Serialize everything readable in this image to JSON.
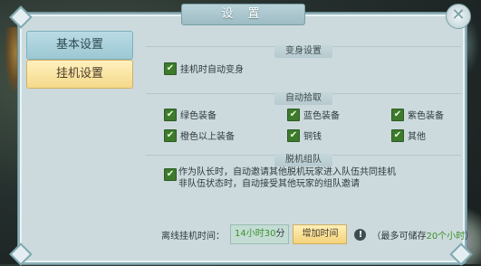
{
  "window": {
    "title": "设 置",
    "close_symbol": "✕"
  },
  "tabs": [
    {
      "label": "基本设置",
      "active": false
    },
    {
      "label": "挂机设置",
      "active": true
    }
  ],
  "sections": {
    "transform": {
      "title": "变身设置",
      "options": [
        {
          "label": "挂机时自动变身",
          "checked": true
        }
      ]
    },
    "pickup": {
      "title": "自动拾取",
      "options": [
        {
          "label": "绿色装备",
          "checked": true
        },
        {
          "label": "蓝色装备",
          "checked": true
        },
        {
          "label": "紫色装备",
          "checked": true
        },
        {
          "label": "橙色以上装备",
          "checked": true
        },
        {
          "label": "铜钱",
          "checked": true
        },
        {
          "label": "其他",
          "checked": true
        }
      ]
    },
    "team": {
      "title": "脱机组队",
      "option": {
        "checked": true,
        "line1": "作为队长时，自动邀请其他脱机玩家进入队伍共同挂机",
        "line2": "非队伍状态时，自动接受其他玩家的组队邀请"
      }
    }
  },
  "footer": {
    "label": "离线挂机时间：",
    "time": {
      "hours": "14",
      "hours_unit": "小时",
      "minutes": "30",
      "minutes_unit": "分"
    },
    "add_button": "增加时间",
    "warn_symbol": "!",
    "note_prefix": "（最多可储存",
    "note_value": "20个小时",
    "note_suffix": "）"
  },
  "colors": {
    "check_green": "#3e7a2e",
    "accent_green": "#3f8f2a",
    "active_tab": "#f5d98a"
  }
}
